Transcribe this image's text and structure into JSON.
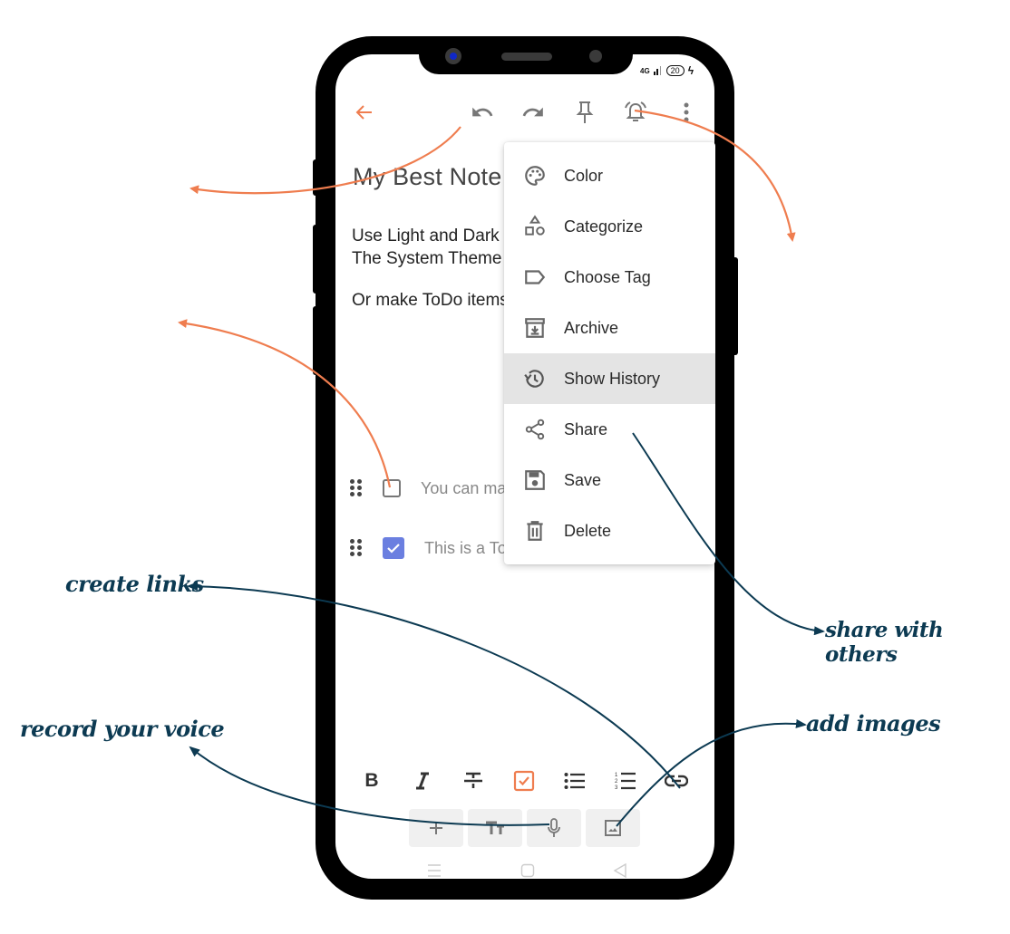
{
  "status_bar": {
    "signal": "4G",
    "battery": "20",
    "charging_icon": "lightning-bolt-icon"
  },
  "toolbar": {
    "back_icon": "arrow-left-icon",
    "undo_icon": "undo-icon",
    "redo_icon": "redo-icon",
    "pin_icon": "pin-icon",
    "reminder_icon": "bell-ringing-icon",
    "more_icon": "more-vertical-icon"
  },
  "note": {
    "title": "My Best Note",
    "body_lines": [
      "Use Light and Dark",
      "The System Theme"
    ],
    "body_line2": "Or make ToDo items",
    "todos": [
      {
        "text": "You can make",
        "checked": false
      },
      {
        "text": "This is a ToDo",
        "checked": true
      }
    ]
  },
  "menu": {
    "items": [
      {
        "label": "Color",
        "icon": "palette-icon"
      },
      {
        "label": "Categorize",
        "icon": "shapes-icon"
      },
      {
        "label": "Choose Tag",
        "icon": "tag-icon"
      },
      {
        "label": "Archive",
        "icon": "archive-icon"
      },
      {
        "label": "Show History",
        "icon": "history-icon",
        "highlighted": true
      },
      {
        "label": "Share",
        "icon": "share-icon"
      },
      {
        "label": "Save",
        "icon": "save-icon"
      },
      {
        "label": "Delete",
        "icon": "trash-icon"
      }
    ]
  },
  "format_bar": {
    "items": [
      "bold-icon",
      "italic-icon",
      "strikethrough-icon",
      "checkbox-icon",
      "bulleted-list-icon",
      "numbered-list-icon",
      "link-icon"
    ]
  },
  "action_bar": {
    "items": [
      "plus-icon",
      "text-size-icon",
      "microphone-icon",
      "image-icon"
    ]
  },
  "nav_bar": {
    "items": [
      "recents-icon",
      "home-icon",
      "back-triangle-icon"
    ]
  },
  "annotations": {
    "create_links": "create links",
    "record_voice": "record your voice",
    "share_with_others": "share with others",
    "add_images": "add images"
  },
  "colors": {
    "accent": "#ef7d4f",
    "annotation": "#0c3a52",
    "checkbox_checked": "#6b7fe0",
    "menu_highlight": "#e4e4e4"
  }
}
